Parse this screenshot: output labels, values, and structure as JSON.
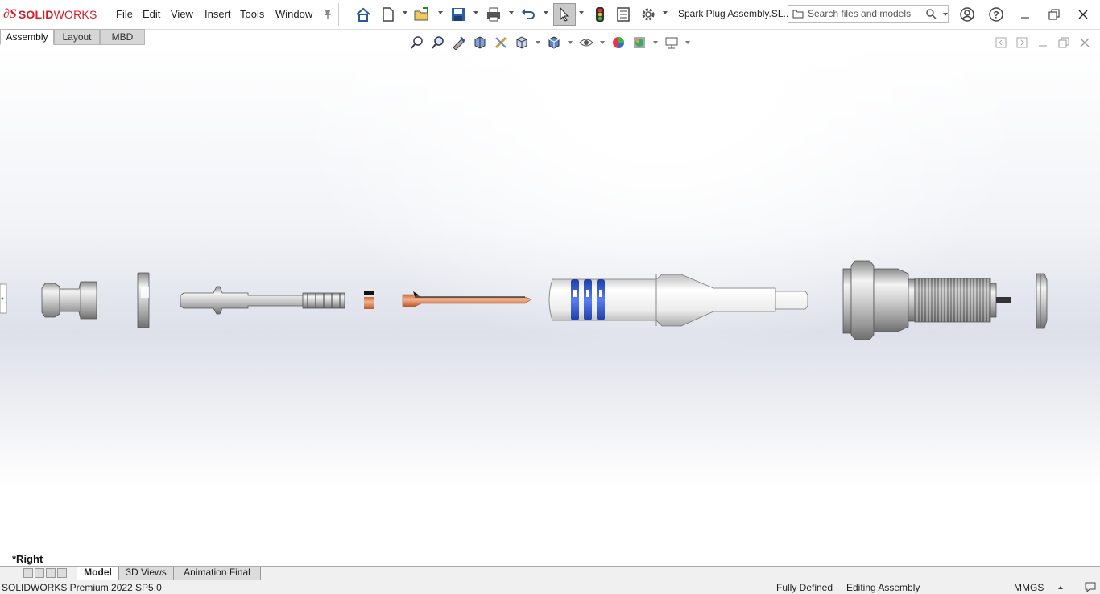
{
  "app": {
    "logo_brand": "SOLID",
    "logo_brand2": "WORKS",
    "document_title": "Spark Plug Assembly.SL..."
  },
  "menu": [
    "File",
    "Edit",
    "View",
    "Insert",
    "Tools",
    "Window"
  ],
  "search": {
    "placeholder": "Search files and models"
  },
  "command_tabs": [
    {
      "label": "Assembly",
      "active": true
    },
    {
      "label": "Layout",
      "active": false
    },
    {
      "label": "MBD",
      "active": false
    }
  ],
  "viewport": {
    "view_name": "*Right"
  },
  "bottom_tabs": [
    {
      "label": "Model",
      "active": true
    },
    {
      "label": "3D Views",
      "active": false
    },
    {
      "label": "Animation Final",
      "active": false
    }
  ],
  "status": {
    "product": "SOLIDWORKS Premium 2022 SP5.0",
    "definition": "Fully Defined",
    "mode": "Editing Assembly",
    "units": "MMGS"
  },
  "colors": {
    "brand_red": "#d21f27",
    "copper": "#e8956b",
    "ceramic_band_blue": "#3a5fd9",
    "metal_gray": "#b8b8b8"
  },
  "icons": {
    "toolbar": [
      "home-icon",
      "new-document-icon",
      "open-icon",
      "save-icon",
      "print-icon",
      "undo-icon",
      "select-icon",
      "traffic-light-icon",
      "options-list-icon",
      "settings-gear-icon"
    ],
    "window": [
      "user-icon",
      "help-icon",
      "minimize-icon",
      "restore-icon",
      "close-icon"
    ],
    "heads_up_view": [
      "zoom-to-fit-icon",
      "zoom-to-area-icon",
      "previous-view-icon",
      "section-view-icon",
      "dynamic-annotation-icon",
      "view-orientation-icon",
      "display-style-icon",
      "hide-show-icon",
      "edit-appearance-icon",
      "apply-scene-icon",
      "view-settings-icon"
    ]
  }
}
